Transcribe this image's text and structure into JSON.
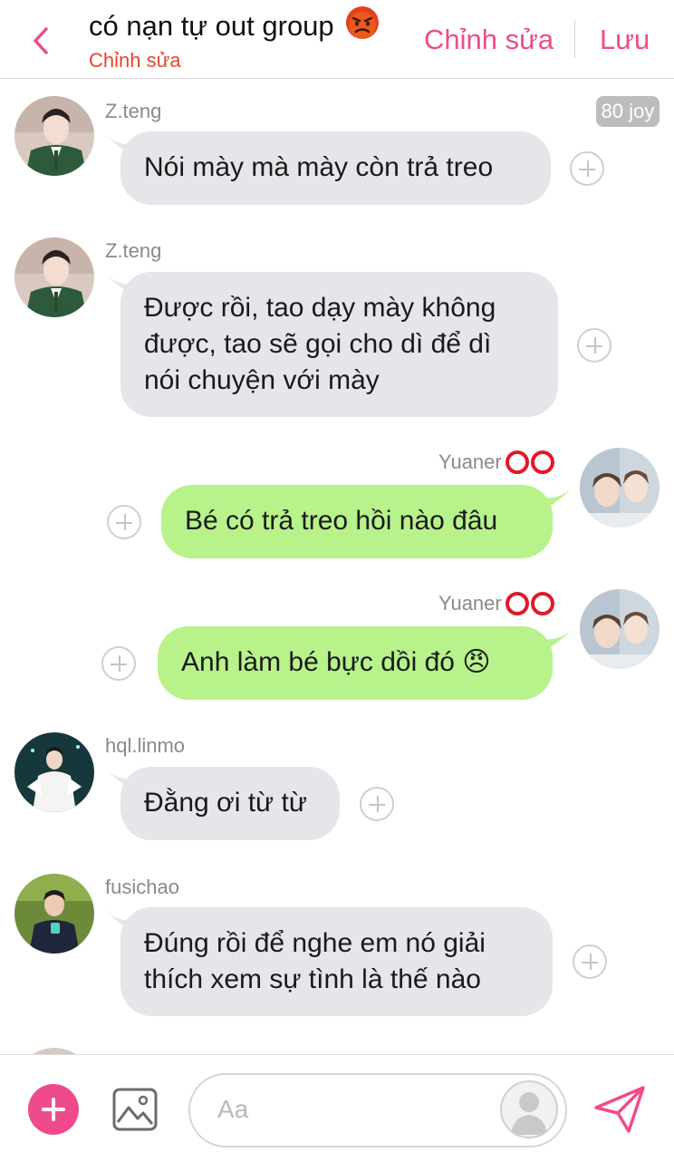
{
  "header": {
    "title": "có nạn tự out group",
    "title_emoji": "😡",
    "subtitle": "Chỉnh sửa",
    "edit_label": "Chỉnh sửa",
    "save_label": "Lưu"
  },
  "badge": "80 joy",
  "messages": [
    {
      "sender": "Z.teng",
      "direction": "in",
      "lines": [
        "Nói mày mà mày còn trả treo"
      ]
    },
    {
      "sender": "Z.teng",
      "direction": "in",
      "lines": [
        "Được rồi, tao dạy mày không",
        "được, tao sẽ gọi cho dì để dì",
        "nói chuyện với mày"
      ]
    },
    {
      "sender": "Yuaner",
      "direction": "out",
      "lines": [
        "Bé có trả treo hồi nào đâu"
      ]
    },
    {
      "sender": "Yuaner",
      "direction": "out",
      "lines": [
        "Anh làm bé bực dồi đó 😠"
      ]
    },
    {
      "sender": "hql.linmo",
      "direction": "in",
      "lines": [
        "Đằng ơi từ từ"
      ]
    },
    {
      "sender": "fusichao",
      "direction": "in",
      "lines": [
        "Đúng rồi để nghe em nó giải",
        "thích xem sự tình là thế nào"
      ]
    }
  ],
  "composer": {
    "placeholder": "Aa"
  },
  "colors": {
    "accent": "#ee4b8c",
    "subtitle": "#e5462f",
    "incoming_bubble": "#e5e6ea",
    "outgoing_bubble": "#b8f28a",
    "ring": "#e0192b"
  },
  "icons": [
    "back-chevron-icon",
    "angry-face-emoji",
    "plus-circle-icon",
    "image-icon",
    "send-icon",
    "add-reaction-icon"
  ]
}
